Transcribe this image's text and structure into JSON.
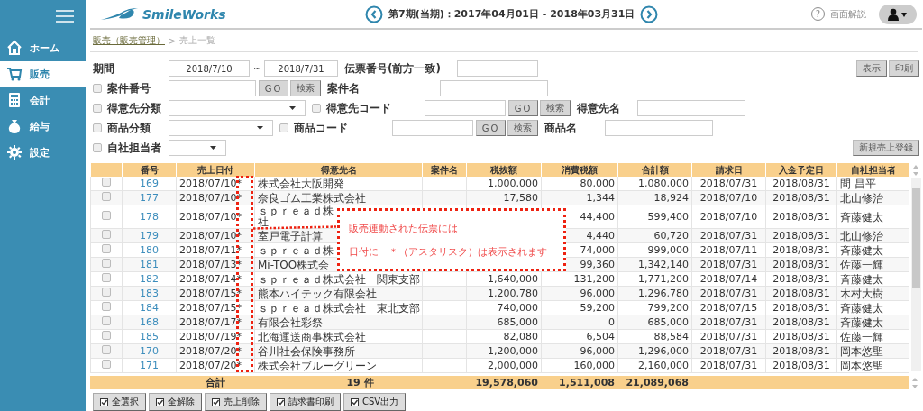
{
  "sidebar": {
    "items": [
      {
        "label": "ホーム",
        "kind": "home",
        "selected": false
      },
      {
        "label": "販売",
        "kind": "cart",
        "selected": true
      },
      {
        "label": "会計",
        "kind": "calc",
        "selected": false
      },
      {
        "label": "給与",
        "kind": "bag",
        "selected": false
      },
      {
        "label": "設定",
        "kind": "gear",
        "selected": false
      }
    ]
  },
  "header": {
    "logo": "SmileWorks",
    "period": "第7期(当期)：2017年04月01日 - 2018年03月31日",
    "help_mark": "?",
    "help": "画面解説"
  },
  "breadcrumb": {
    "link": "販売（販売管理）",
    "separator": ">",
    "current": "売上一覧"
  },
  "filters": {
    "period": {
      "label": "期間",
      "from": "2018/7/10",
      "separator": "～",
      "to": "2018/7/31"
    },
    "slip_no": {
      "label": "伝票番号(前方一致)"
    },
    "project_no": {
      "label": "案件番号",
      "checked": false,
      "buttons": [
        "GO",
        "検索"
      ]
    },
    "project_name": {
      "label": "案件名"
    },
    "customer_category": {
      "label": "得意先分類",
      "checked": false
    },
    "customer_code": {
      "label": "得意先コード",
      "checked": false,
      "buttons": [
        "GO",
        "検索"
      ]
    },
    "customer_name": {
      "label": "得意先名"
    },
    "product_category": {
      "label": "商品分類",
      "checked": false
    },
    "product_code": {
      "label": "商品コード",
      "checked": false,
      "buttons": [
        "GO",
        "検索"
      ]
    },
    "product_name": {
      "label": "商品名"
    },
    "staff": {
      "label": "自社担当者",
      "checked": false
    }
  },
  "top_buttons": [
    "表示",
    "印刷"
  ],
  "new_button": "新規売上登録",
  "table": {
    "columns": [
      "番号",
      "売上日付",
      "得意先名",
      "案件名",
      "税抜額",
      "消費税額",
      "合計額",
      "請求日",
      "入金予定日",
      "自社担当者"
    ],
    "rows": [
      {
        "checked": false,
        "cells": [
          "169",
          "2018/07/10*",
          "株式会社大阪開発",
          null,
          "1,000,000",
          "80,000",
          "1,080,000",
          "2018/07/31",
          "2018/08/31",
          "間 昌平"
        ]
      },
      {
        "checked": false,
        "cells": [
          "177",
          "2018/07/10*",
          "奈良ゴム工業株式会社",
          null,
          "17,580",
          "1,344",
          "18,924",
          "2018/07/10",
          "2018/08/31",
          "北山修治"
        ]
      },
      {
        "checked": false,
        "cells": [
          "178",
          "2018/07/10*",
          "ｓｐｒｅａｄ株社",
          null,
          null,
          "44,400",
          "599,400",
          "2018/07/10",
          "2018/08/31",
          "斉藤健太"
        ]
      },
      {
        "checked": false,
        "cells": [
          "179",
          "2018/07/10*",
          "室戸電子計算",
          null,
          null,
          "4,440",
          "60,720",
          "2018/07/31",
          "2018/08/31",
          "北山修治"
        ]
      },
      {
        "checked": false,
        "cells": [
          "180",
          "2018/07/11*",
          "ｓｐｒｅａｄ株",
          null,
          null,
          "74,000",
          "999,000",
          "2018/07/11",
          "2018/08/31",
          "斉藤健太"
        ]
      },
      {
        "checked": false,
        "cells": [
          "181",
          "2018/07/13*",
          "Mi-TOO株式会",
          null,
          null,
          "99,360",
          "1,342,140",
          "2018/07/31",
          "2018/08/31",
          "佐藤一輝"
        ]
      },
      {
        "checked": false,
        "cells": [
          "182",
          "2018/07/14*",
          "ｓｐｒｅａｄ株式会社　関東支部",
          null,
          "1,640,000",
          "131,200",
          "1,771,200",
          "2018/07/14",
          "2018/08/31",
          "斉藤健太"
        ]
      },
      {
        "checked": false,
        "cells": [
          "183",
          "2018/07/15*",
          "熊本ハイテック有限会社",
          null,
          "1,200,780",
          "96,000",
          "1,296,780",
          "2018/07/31",
          "2018/08/31",
          "木村大樹"
        ]
      },
      {
        "checked": false,
        "cells": [
          "184",
          "2018/07/15*",
          "ｓｐｒｅａｄ株式会社　東北支部",
          null,
          "740,000",
          "59,200",
          "799,200",
          "2018/07/15",
          "2018/08/31",
          "斉藤健太"
        ]
      },
      {
        "checked": false,
        "cells": [
          "168",
          "2018/07/17*",
          "有限会社彩祭",
          null,
          "685,000",
          "0",
          "685,000",
          "2018/07/31",
          "2018/08/31",
          "斉藤健太"
        ]
      },
      {
        "checked": false,
        "cells": [
          "185",
          "2018/07/19*",
          "北海運送商事株式会社",
          null,
          "82,080",
          "6,504",
          "88,584",
          "2018/07/31",
          "2018/08/31",
          "佐藤一輝"
        ]
      },
      {
        "checked": false,
        "cells": [
          "170",
          "2018/07/20*",
          "谷川社会保険事務所",
          null,
          "1,200,000",
          "96,000",
          "1,296,000",
          "2018/07/31",
          "2018/08/31",
          "岡本悠聖"
        ]
      },
      {
        "checked": false,
        "cells": [
          "171",
          "2018/07/20*",
          "株式会社ブルーグリーン",
          null,
          "2,000,000",
          "160,000",
          "2,160,000",
          "2018/07/31",
          "2018/08/31",
          "岡本悠聖"
        ]
      }
    ],
    "totals": {
      "label": "合計",
      "count": "19 件",
      "excl": "19,578,060",
      "tax": "1,511,008",
      "total": "21,089,068"
    }
  },
  "bottom_buttons": [
    "全選択",
    "全解除",
    "売上削除",
    "請求書印刷",
    "CSV出力"
  ],
  "callout": {
    "lines": [
      "販売連動された伝票には",
      "日付に　＊（アスタリスク）は表示されます"
    ]
  }
}
